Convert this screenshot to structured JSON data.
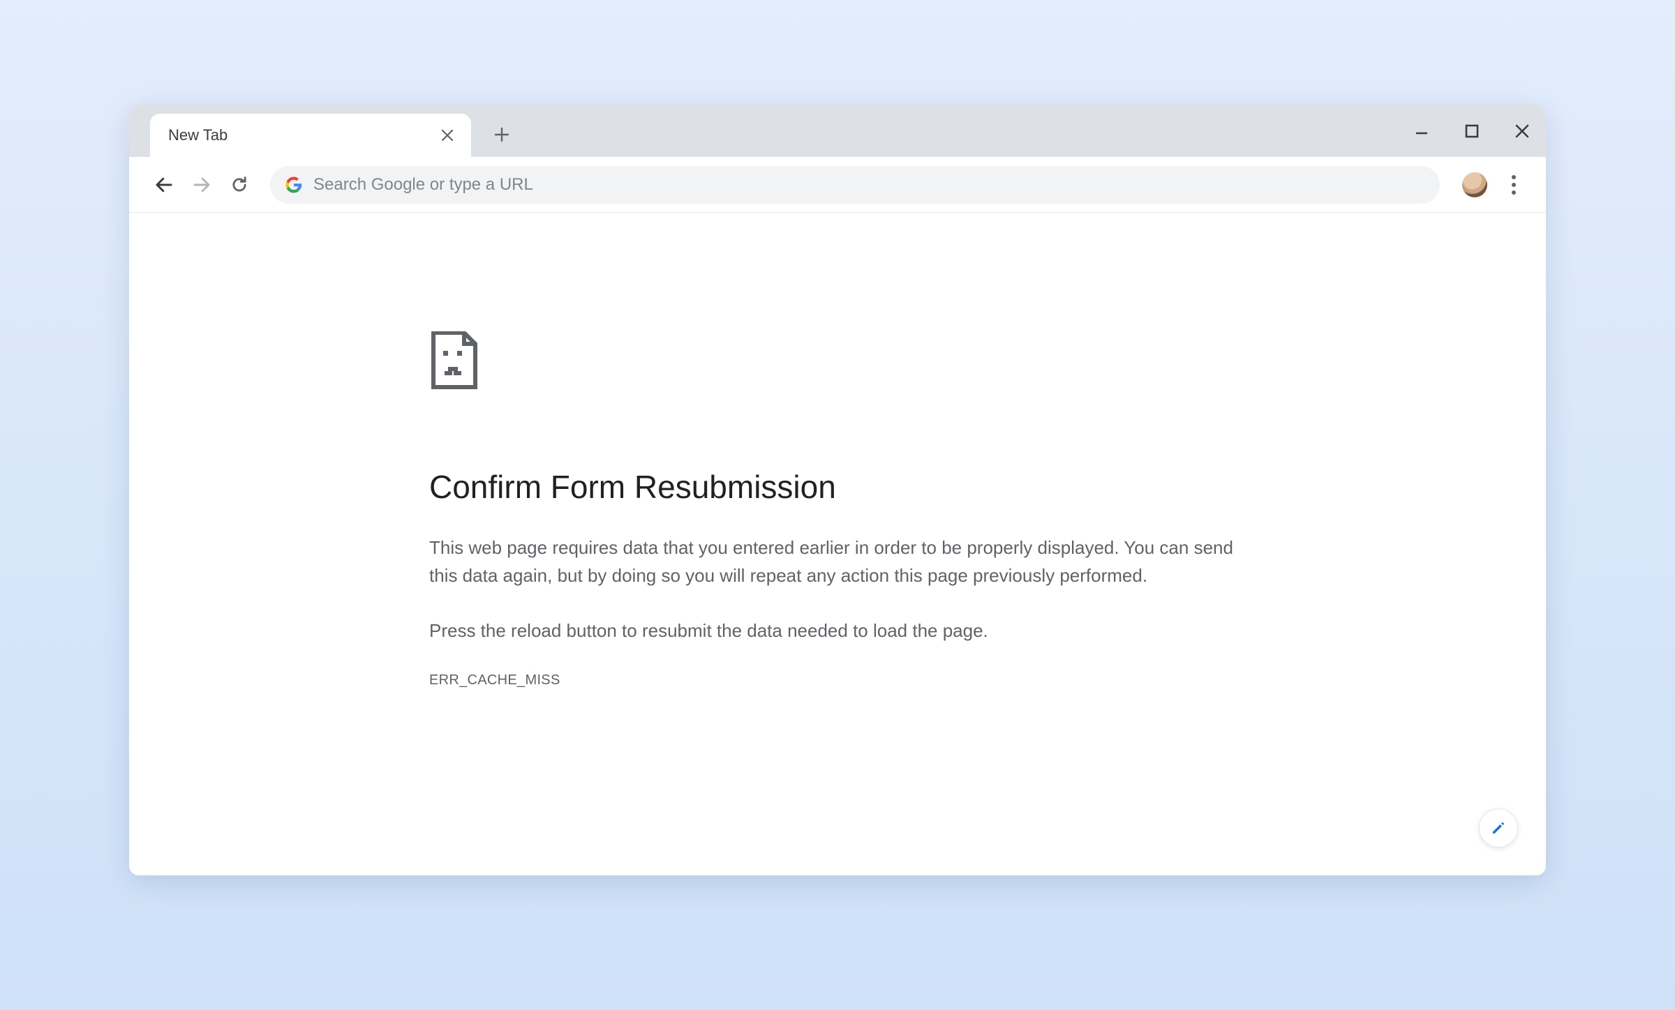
{
  "tab": {
    "title": "New Tab"
  },
  "toolbar": {
    "omnibox_placeholder": "Search Google or type a URL"
  },
  "error": {
    "title": "Confirm Form Resubmission",
    "body1": "This web page requires data that you entered earlier in order to be properly displayed. You can send this data again, but by doing so you will repeat any action this page previously performed.",
    "body2": "Press the reload button to resubmit the data needed to load the page.",
    "code": "ERR_CACHE_MISS"
  },
  "icons": {
    "google": "google-logo-icon",
    "sad_page": "sad-page-icon",
    "pencil": "pencil-icon"
  }
}
